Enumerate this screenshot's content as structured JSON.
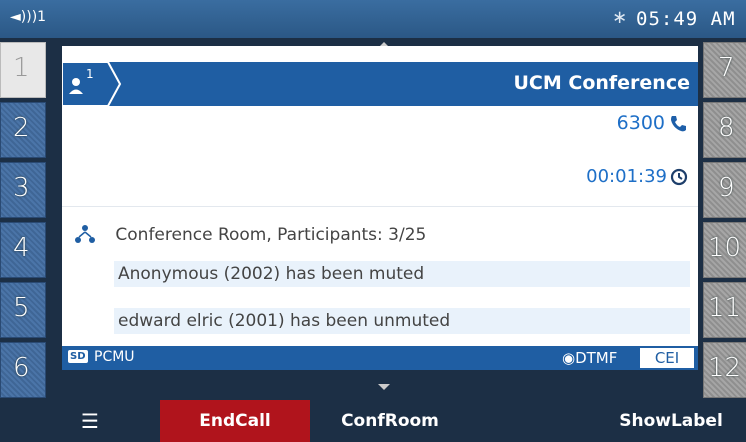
{
  "status_bar": {
    "volume_icon": "speaker-icon",
    "volume_level": "1",
    "bluetooth_icon": "bluetooth-icon",
    "time": "05:49 AM"
  },
  "line_keys_left": [
    "1",
    "2",
    "3",
    "4",
    "5",
    "6"
  ],
  "line_keys_right": [
    "7",
    "8",
    "9",
    "10",
    "11",
    "12"
  ],
  "call": {
    "participant_icon": "person-icon",
    "participant_count": "1",
    "title": "UCM Conference",
    "number": "6300",
    "number_icon": "phone-icon",
    "duration": "00:01:39",
    "duration_icon": "clock-icon"
  },
  "conference": {
    "icon": "conference-icon",
    "label": "Conference Room, Participants: 3/25",
    "messages": [
      "Anonymous (2002) has been muted",
      "edward elric (2001) has been unmuted"
    ]
  },
  "info_bar": {
    "sd_badge": "SD",
    "codec": "PCMU",
    "dtmf": "DTMF",
    "cei": "CEI"
  },
  "softkeys": {
    "menu_icon": "menu-icon",
    "end_call": "EndCall",
    "conf_room": "ConfRoom",
    "show_label": "ShowLabel"
  },
  "colors": {
    "accent": "#1f5ea3",
    "end_call": "#b0141c"
  }
}
